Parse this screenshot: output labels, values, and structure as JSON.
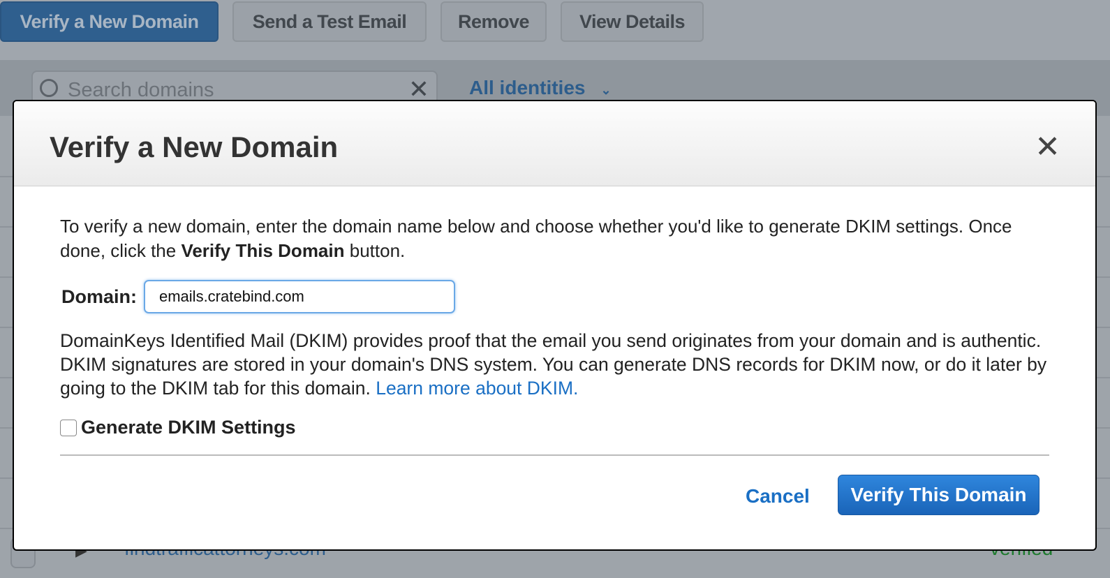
{
  "toolbar": {
    "verify_new": "Verify a New Domain",
    "send_test": "Send a Test Email",
    "remove": "Remove",
    "view_details": "View Details"
  },
  "filter": {
    "search_placeholder": "Search domains",
    "clear": "✕",
    "identities": "All identities",
    "chevron": "⌄"
  },
  "background_row": {
    "domain": "findtrafficattorneys.com",
    "status": "verified",
    "status_color": "#1e7a2e"
  },
  "modal": {
    "title": "Verify a New Domain",
    "close": "✕",
    "intro_1": "To verify a new domain, enter the domain name below and choose whether you'd like to generate DKIM settings. Once done, click the ",
    "intro_bold": "Verify This Domain",
    "intro_2": " button.",
    "domain_label": "Domain:",
    "domain_value": "emails.cratebind.com",
    "dkim_text": "DomainKeys Identified Mail (DKIM) provides proof that the email you send originates from your domain and is authentic. DKIM signatures are stored in your domain's DNS system. You can generate DNS records for DKIM now, or do it later by going to the DKIM tab for this domain. ",
    "dkim_link": "Learn more about DKIM.",
    "checkbox_label": "Generate DKIM Settings",
    "checkbox_checked": false,
    "cancel": "Cancel",
    "verify": "Verify This Domain"
  },
  "colors": {
    "primary": "#1a6fc4",
    "overlay": "#9ea4aa"
  }
}
